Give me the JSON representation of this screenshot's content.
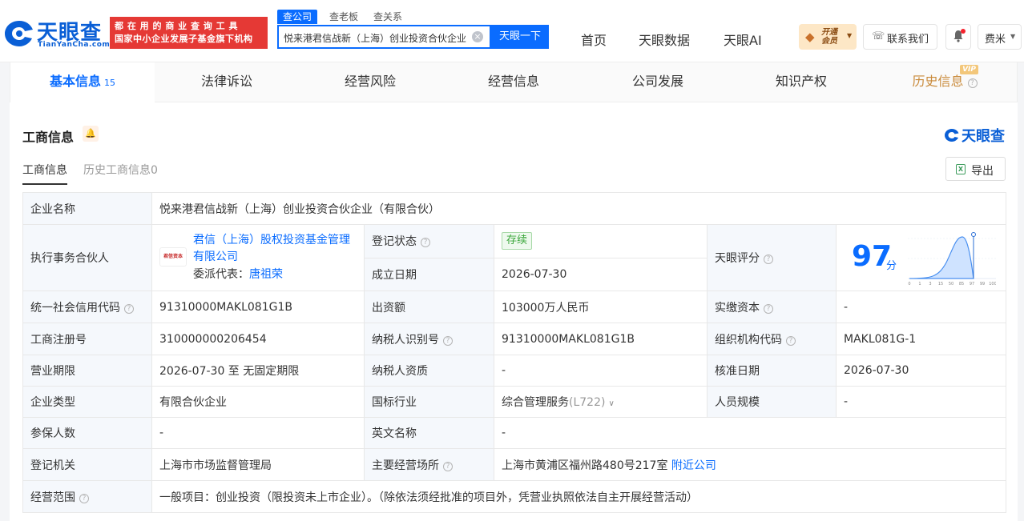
{
  "header": {
    "logo_text": "天眼查",
    "logo_sub": "TianYanCha.com",
    "slogan_line1": "都 在 用 的 商 业 查 询 工 具",
    "slogan_line2": "国家中小企业发展子基金旗下机构",
    "search_tabs": [
      "查公司",
      "查老板",
      "查关系"
    ],
    "search_value": "悦来港君信战新（上海）创业投资合伙企业",
    "search_button": "天眼一下",
    "nav": [
      "首页",
      "天眼数据",
      "天眼AI"
    ],
    "vip_line1": "开通",
    "vip_line2": "会员",
    "contact_label": "联系我们",
    "user_label": "费米"
  },
  "main_tabs": [
    {
      "label": "基本信息",
      "count": "15"
    },
    {
      "label": "法律诉讼"
    },
    {
      "label": "经营风险"
    },
    {
      "label": "经营信息"
    },
    {
      "label": "公司发展"
    },
    {
      "label": "知识产权"
    },
    {
      "label": "历史信息",
      "badge": "VIP"
    }
  ],
  "section": {
    "title": "工商信息",
    "brand": "天眼查",
    "sub_tabs": [
      "工商信息",
      "历史工商信息0"
    ],
    "export_label": "导出"
  },
  "info": {
    "company_name_label": "企业名称",
    "company_name": "悦来港君信战新（上海）创业投资合伙企业（有限合伙）",
    "partner_label": "执行事务合伙人",
    "partner_logo_text": "君信资本",
    "partner_name": "君信（上海）股权投资基金管理有限公司",
    "rep_label": "委派代表：",
    "rep_name": "唐祖荣",
    "reg_status_label": "登记状态",
    "reg_status": "存续",
    "est_date_label": "成立日期",
    "est_date": "2026-07-30",
    "score_label": "天眼评分",
    "score": "97",
    "score_unit": "分",
    "score_ticks": [
      "0",
      "1",
      "3",
      "15",
      "50",
      "85",
      "97",
      "99",
      "100"
    ],
    "credit_code_label": "统一社会信用代码",
    "credit_code": "91310000MAKL081G1B",
    "capital_label": "出资额",
    "capital": "103000万人民币",
    "paid_capital_label": "实缴资本",
    "paid_capital": "-",
    "reg_no_label": "工商注册号",
    "reg_no": "310000000206454",
    "tax_id_label": "纳税人识别号",
    "tax_id": "91310000MAKL081G1B",
    "org_code_label": "组织机构代码",
    "org_code": "MAKL081G-1",
    "term_label": "营业期限",
    "term": "2026-07-30 至 无固定期限",
    "tax_qual_label": "纳税人资质",
    "tax_qual": "-",
    "approve_date_label": "核准日期",
    "approve_date": "2026-07-30",
    "type_label": "企业类型",
    "type": "有限合伙企业",
    "industry_label": "国标行业",
    "industry": "综合管理服务",
    "industry_code": "(L722)",
    "staff_label": "人员规模",
    "staff": "-",
    "insured_label": "参保人数",
    "insured": "-",
    "english_label": "英文名称",
    "english": "-",
    "authority_label": "登记机关",
    "authority": "上海市市场监督管理局",
    "address_label": "主要经营场所",
    "address": "上海市黄浦区福州路480号217室",
    "nearby_link": "附近公司",
    "scope_label": "经营范围",
    "scope": "一般项目：创业投资（限投资未上市企业）。（除依法须经批准的项目外，凭营业执照依法自主开展经营活动）"
  },
  "colors": {
    "brand": "#0a6cff",
    "slogan_bg": "#e53935",
    "vip_bg": "#fde7c6"
  }
}
